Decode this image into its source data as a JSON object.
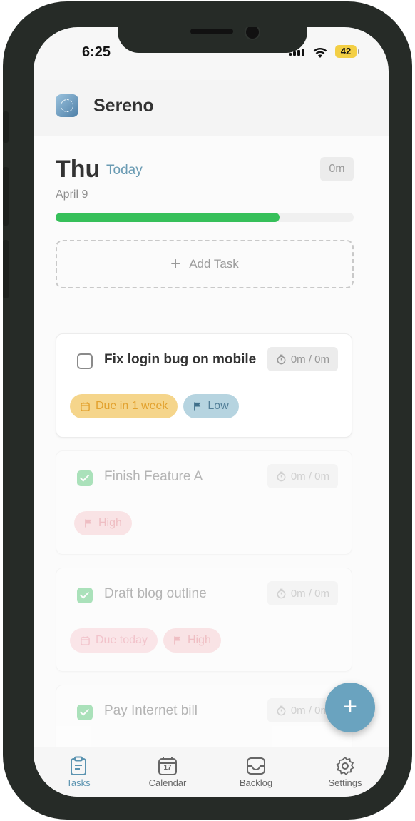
{
  "status_bar": {
    "time": "6:25",
    "battery": "42"
  },
  "app": {
    "name": "Sereno"
  },
  "day_header": {
    "weekday": "Thu",
    "relative_label": "Today",
    "date": "April 9",
    "total_time": "0m",
    "progress_fraction": 0.75
  },
  "add_task": {
    "label": "Add Task"
  },
  "tasks": [
    {
      "title": "Fix login bug on mobile",
      "time": "0m / 0m",
      "completed": false,
      "tags": [
        {
          "type": "due",
          "label": "Due in 1 week",
          "icon": "calendar-icon"
        },
        {
          "type": "priority",
          "label": "Low",
          "icon": "flag-icon"
        }
      ]
    },
    {
      "title": "Finish Feature A",
      "time": "0m / 0m",
      "completed": true,
      "tags": [
        {
          "type": "priority",
          "label": "High",
          "icon": "flag-icon"
        }
      ]
    },
    {
      "title": "Draft blog outline",
      "time": "0m / 0m",
      "completed": true,
      "tags": [
        {
          "type": "due",
          "label": "Due today",
          "icon": "calendar-icon"
        },
        {
          "type": "priority",
          "label": "High",
          "icon": "flag-icon"
        }
      ]
    },
    {
      "title": "Pay Internet bill",
      "time": "0m / 0m",
      "completed": true,
      "tags": []
    }
  ],
  "fab": {
    "label": "+"
  },
  "tab_bar": {
    "items": [
      {
        "label": "Tasks",
        "icon": "clipboard-icon",
        "active": true
      },
      {
        "label": "Calendar",
        "icon": "calendar-icon",
        "badge": "17",
        "active": false
      },
      {
        "label": "Backlog",
        "icon": "inbox-icon",
        "active": false
      },
      {
        "label": "Settings",
        "icon": "gear-icon",
        "active": false
      }
    ]
  },
  "colors": {
    "accent": "#6aa3bf",
    "progress": "#36c05a",
    "checkbox_done": "#3bbf62",
    "frame": "#262b27"
  }
}
